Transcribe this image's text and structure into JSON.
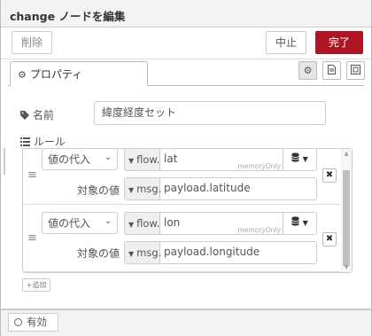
{
  "header": {
    "title": "change ノードを編集"
  },
  "toolbar": {
    "delete_label": "削除",
    "cancel_label": "中止",
    "done_label": "完了"
  },
  "tabs": {
    "properties_label": "プロパティ"
  },
  "icons": {
    "gear": "gear-icon",
    "doc": "document-icon",
    "frame": "frame-icon",
    "tag": "tag-icon",
    "list": "list-icon",
    "db": "database-icon"
  },
  "form": {
    "name_label": "名前",
    "name_value": "緯度経度セット",
    "rules_label": "ルール"
  },
  "rules": [
    {
      "action": "値の代入",
      "target_type": "flow.",
      "target_value": "lat",
      "store_hint": "memoryOnly",
      "value_label": "対象の値",
      "value_type": "msg.",
      "value_value": "payload.latitude"
    },
    {
      "action": "値の代入",
      "target_type": "flow.",
      "target_value": "lon",
      "store_hint": "memoryOnly",
      "value_label": "対象の値",
      "value_type": "msg.",
      "value_value": "payload.longitude"
    }
  ],
  "add_label": "追加",
  "footer": {
    "enabled_label": "有効"
  },
  "colors": {
    "done": "#ad1625"
  }
}
